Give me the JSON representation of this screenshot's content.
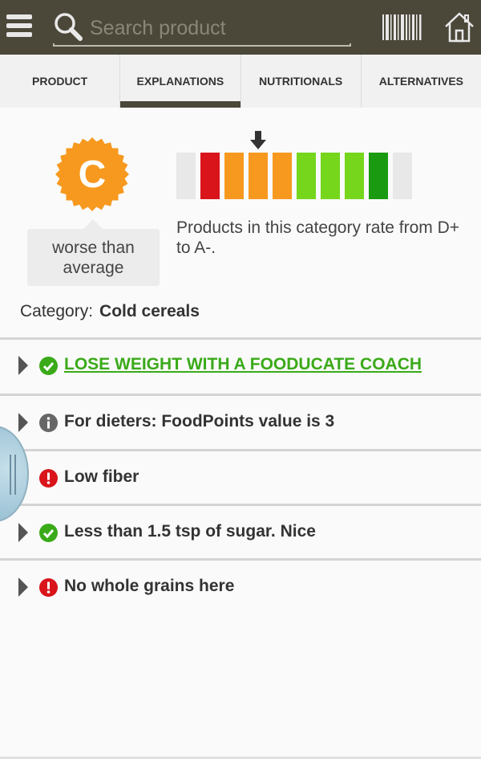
{
  "header": {
    "search_placeholder": "Search product",
    "icons": {
      "menu": "hamburger-menu-icon",
      "search": "search-icon",
      "barcode": "barcode-icon",
      "home": "home-icon"
    },
    "bar_color": "#4b4739"
  },
  "tabs": [
    {
      "label": "PRODUCT",
      "active": false
    },
    {
      "label": "EXPLANATIONS",
      "active": true
    },
    {
      "label": "NUTRITIONALS",
      "active": false
    },
    {
      "label": "ALTERNATIVES",
      "active": false
    }
  ],
  "grade": {
    "letter": "C",
    "badge_color": "#f7991f",
    "comparison": "worse than average"
  },
  "scale": {
    "segments": [
      "#e8e8e8",
      "#d9141b",
      "#f7991f",
      "#f7991f",
      "#f7991f",
      "#76d61c",
      "#76d61c",
      "#76d61c",
      "#1a9a10",
      "#e8e8e8"
    ],
    "marker_index": 3,
    "text": "Products in this category rate from D+ to A-."
  },
  "category": {
    "label": "Category:",
    "value": "Cold cereals"
  },
  "items": [
    {
      "text": "LOSE WEIGHT WITH A FOODUCATE COACH",
      "status": "check",
      "link": true
    },
    {
      "text": "For dieters: FoodPoints value is 3",
      "status": "info",
      "link": false
    },
    {
      "text": "Low fiber",
      "status": "alert",
      "link": false
    },
    {
      "text": "Less than 1.5 tsp of sugar. Nice",
      "status": "check",
      "link": false
    },
    {
      "text": "No whole grains here",
      "status": "alert",
      "link": false
    }
  ],
  "status_colors": {
    "check": "#3aaa19",
    "info": "#666666",
    "alert": "#d9141b"
  }
}
